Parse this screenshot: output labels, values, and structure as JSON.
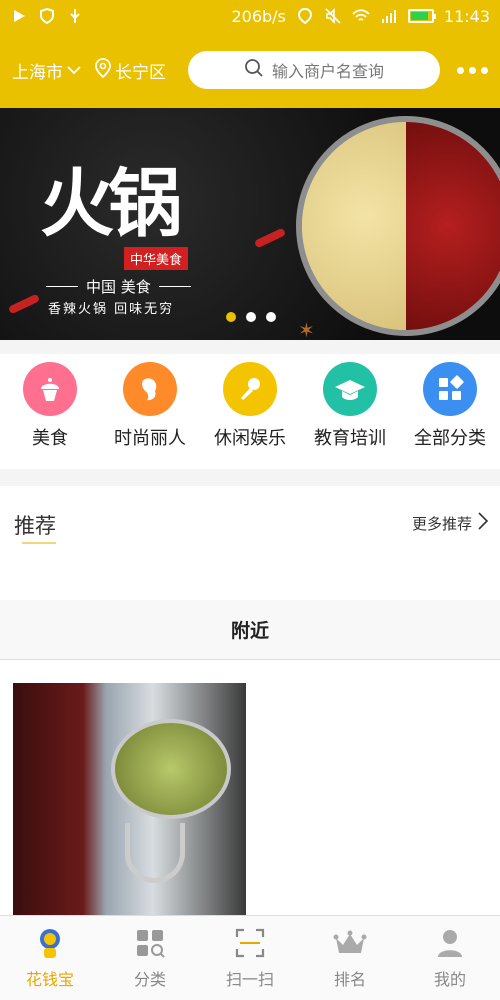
{
  "status_bar": {
    "speed": "206b/s",
    "time": "11:43"
  },
  "header": {
    "city": "上海市",
    "district": "长宁区",
    "search_placeholder": "输入商户名查询"
  },
  "banner": {
    "big_title": "火锅",
    "tag": "中华美食",
    "line1": "中国 美食",
    "line2": "香辣火锅 回味无穷"
  },
  "categories": [
    {
      "label": "美食",
      "color": "#ff6f8f"
    },
    {
      "label": "时尚丽人",
      "color": "#ff8a2a"
    },
    {
      "label": "休闲娱乐",
      "color": "#f5c400"
    },
    {
      "label": "教育培训",
      "color": "#22c1a5"
    },
    {
      "label": "全部分类",
      "color": "#3b8ff0"
    }
  ],
  "recommend": {
    "title": "推荐",
    "more": "更多推荐"
  },
  "nearby": {
    "title": "附近"
  },
  "tabs": [
    {
      "label": "花钱宝"
    },
    {
      "label": "分类"
    },
    {
      "label": "扫一扫"
    },
    {
      "label": "排名"
    },
    {
      "label": "我的"
    }
  ]
}
